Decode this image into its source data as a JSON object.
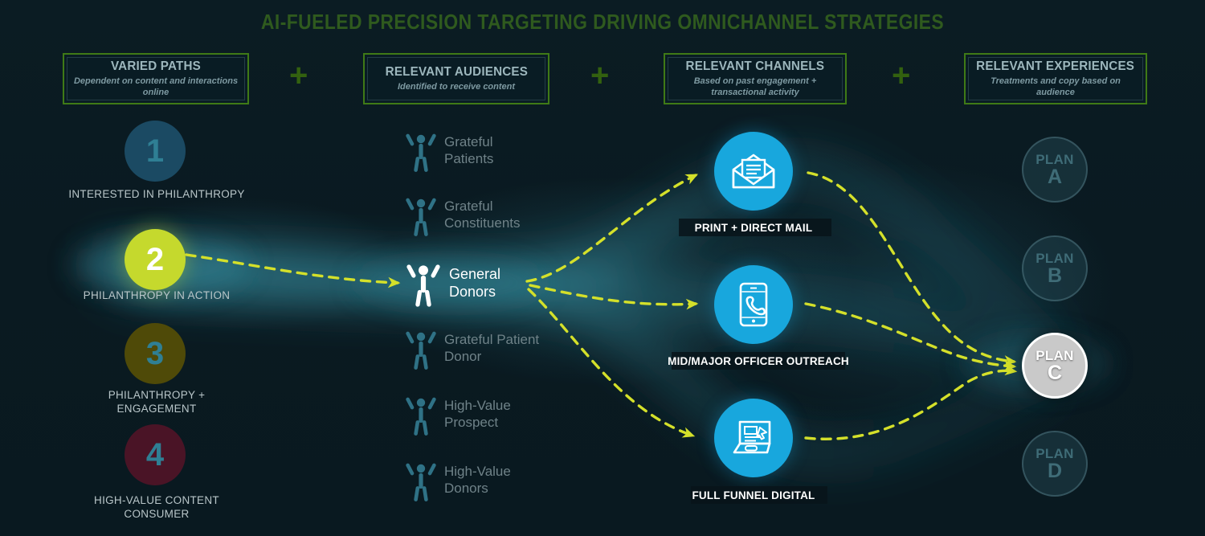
{
  "title": "AI-FUELED PRECISION TARGETING DRIVING OMNICHANNEL STRATEGIES",
  "colors": {
    "background": "#0a1a21",
    "title_green": "#2f5a1e",
    "box_border_green": "#3f7a16",
    "accent_yellow": "#d4e02a",
    "channel_blue": "#18a7dd",
    "highlight_green": "#c5d92d",
    "plan_active_gray": "#c9c9c9"
  },
  "headers": [
    {
      "title": "VARIED PATHS",
      "subtitle": "Dependent on content and interactions online"
    },
    {
      "title": "RELEVANT AUDIENCES",
      "subtitle": "Identified to receive content"
    },
    {
      "title": "RELEVANT CHANNELS",
      "subtitle": "Based on past engagement + transactional activity"
    },
    {
      "title": "RELEVANT EXPERIENCES",
      "subtitle": "Treatments and copy based on audience"
    }
  ],
  "separators": [
    "+",
    "+",
    "+"
  ],
  "paths": [
    {
      "number": "1",
      "label": "INTERESTED IN PHILANTHROPY",
      "fill": "#1b4a63",
      "number_color": "#2f7f94",
      "active": false
    },
    {
      "number": "2",
      "label": "PHILANTHROPY IN ACTION",
      "fill": "#c5d92d",
      "number_color": "#ffffff",
      "active": true
    },
    {
      "number": "3",
      "label": "PHILANTHROPY + ENGAGEMENT",
      "fill": "#4f4a08",
      "number_color": "#2f7f94",
      "active": false
    },
    {
      "number": "4",
      "label": "HIGH-VALUE CONTENT CONSUMER",
      "fill": "#4a1426",
      "number_color": "#2f7f94",
      "active": false
    }
  ],
  "audiences": [
    {
      "label": "Grateful Patients",
      "active": false
    },
    {
      "label": "Grateful Constituents",
      "active": false
    },
    {
      "label": "General Donors",
      "active": true
    },
    {
      "label": "Grateful Patient Donor",
      "active": false
    },
    {
      "label": "High-Value Prospect",
      "active": false
    },
    {
      "label": "High-Value Donors",
      "active": false
    }
  ],
  "channels": [
    {
      "label": "PRINT + DIRECT MAIL",
      "icon": "envelope-icon"
    },
    {
      "label": "MID/MAJOR OFFICER OUTREACH",
      "icon": "mobile-phone-icon"
    },
    {
      "label": "FULL FUNNEL DIGITAL",
      "icon": "laptop-icon"
    }
  ],
  "experiences": [
    {
      "word": "PLAN",
      "letter": "A",
      "active": false
    },
    {
      "word": "PLAN",
      "letter": "B",
      "active": false
    },
    {
      "word": "PLAN",
      "letter": "C",
      "active": true
    },
    {
      "word": "PLAN",
      "letter": "D",
      "active": false
    }
  ]
}
